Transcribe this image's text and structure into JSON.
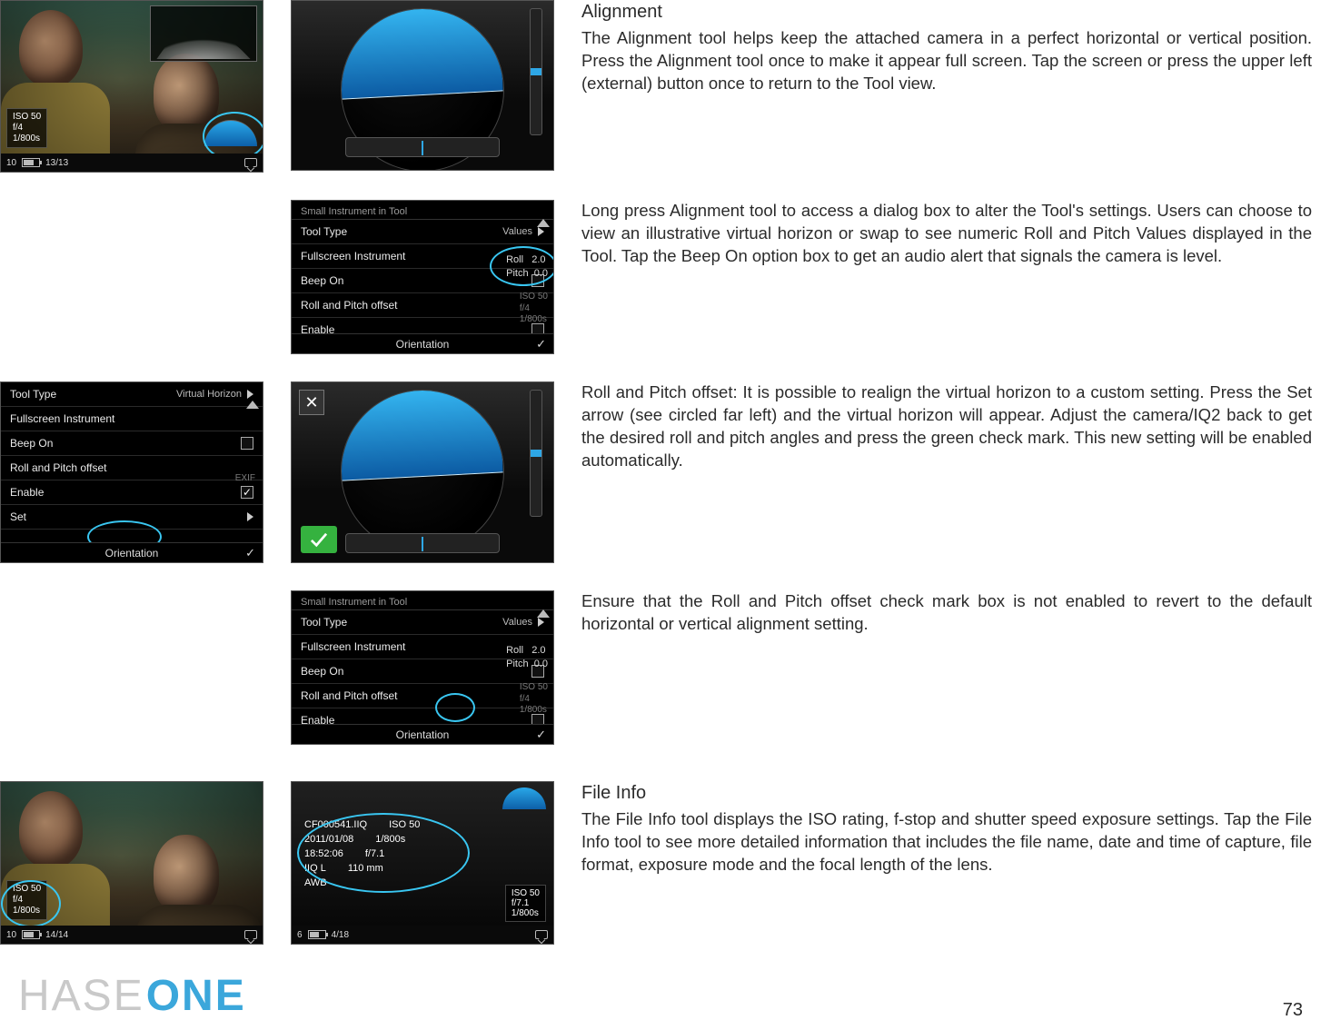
{
  "sections": {
    "alignment": {
      "heading": "Alignment",
      "p1": "The Alignment tool helps keep the attached camera in a perfect horizontal or vertical position. Press the Alignment tool once to make it appear full screen. Tap the screen or press the upper left (external) button once to return to the Tool view.",
      "p2": "Long press Alignment tool to access a dialog box to alter the Tool's settings. Users can choose to view an illustrative virtual horizon or swap to see numeric Roll and Pitch Values displayed in the Tool.  Tap the Beep On option box to get an audio alert that signals the camera is level.",
      "p3": "Roll and Pitch offset: It is possible to realign the virtual horizon to a custom setting. Press the Set arrow (see circled far left) and the virtual horizon will appear. Adjust the camera/IQ2 back to get the desired roll and pitch angles and press the green check mark. This new setting will be enabled automatically.",
      "p4": "Ensure that the Roll and Pitch offset check mark box is not enabled to revert to the default horizontal or vertical alignment setting."
    },
    "fileinfo": {
      "heading": "File Info",
      "p": "The File Info tool displays the ISO rating, f-stop and shutter speed exposure settings.  Tap the File Info tool to see more detailed information that includes the file name, date and time of capture, file format, exposure mode and the focal length of the lens."
    }
  },
  "photo1": {
    "iso": "ISO 50",
    "aperture": "f/4",
    "shutter": "1/800s",
    "counter": "13/13",
    "storage_label": "10"
  },
  "photo_fileinfo_left": {
    "iso": "ISO 50",
    "aperture": "f/4",
    "shutter": "1/800s",
    "counter": "14/14",
    "storage_label": "10"
  },
  "settings_panel": {
    "section_label": "Small Instrument in Tool",
    "rows": {
      "tool_type": {
        "label": "Tool Type",
        "value_values": "Values",
        "value_vh": "Virtual Horizon"
      },
      "fullscreen": {
        "label": "Fullscreen Instrument"
      },
      "beep_on": {
        "label": "Beep On"
      },
      "rp_offset": {
        "label": "Roll and Pitch offset"
      },
      "enable": {
        "label": "Enable"
      },
      "set": {
        "label": "Set"
      }
    },
    "roll_label": "Roll",
    "roll_value": "2.0",
    "pitch_label": "Pitch",
    "pitch_value": "0.0",
    "ghost_iso": "ISO 50",
    "ghost_aperture": "f/4",
    "ghost_shutter": "1/800s",
    "orientation_label": "Orientation"
  },
  "align_panel_set": {
    "close_symbol": "✕"
  },
  "fileinfo_panel": {
    "filename": "CF000541.IIQ",
    "date": "2011/01/08",
    "time": "18:52:06",
    "format": "IIQ L",
    "wb": "AWB",
    "iso": "ISO 50",
    "shutter": "1/800s",
    "aperture": "f/7.1",
    "focal": "110 mm",
    "rb_iso": "ISO 50",
    "rb_aperture": "f/7.1",
    "rb_shutter": "1/800s",
    "counter": "4/18",
    "storage_label": "6"
  },
  "footer": {
    "brand_left": "HASE",
    "brand_accent": "ONE",
    "page": "73"
  }
}
